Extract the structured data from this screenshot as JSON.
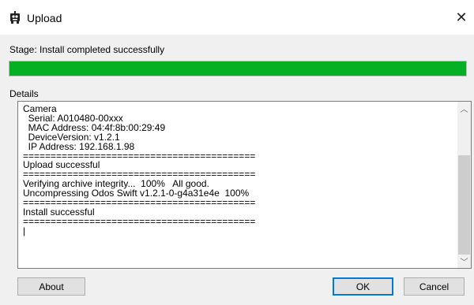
{
  "window": {
    "title": "Upload",
    "icon": "robot-icon"
  },
  "stage": {
    "label": "Stage: Install completed successfully",
    "progress_percent": 100,
    "progress_color": "#06b025"
  },
  "details": {
    "label": "Details",
    "log_lines": [
      "Camera",
      "  Serial: A010480-00xxx",
      "  MAC Address: 04:4f:8b:00:29:49",
      "  DeviceVersion: v1.2.1",
      "  IP Address: 192.168.1.98",
      "==========================================",
      "Upload successful",
      "==========================================",
      "Verifying archive integrity...  100%   All good.",
      "Uncompressing Odos Swift v1.2.1-0-g4a31e4e  100%",
      "==========================================",
      "Install successful",
      "==========================================",
      "|"
    ]
  },
  "buttons": {
    "about": "About",
    "ok": "OK",
    "cancel": "Cancel"
  }
}
